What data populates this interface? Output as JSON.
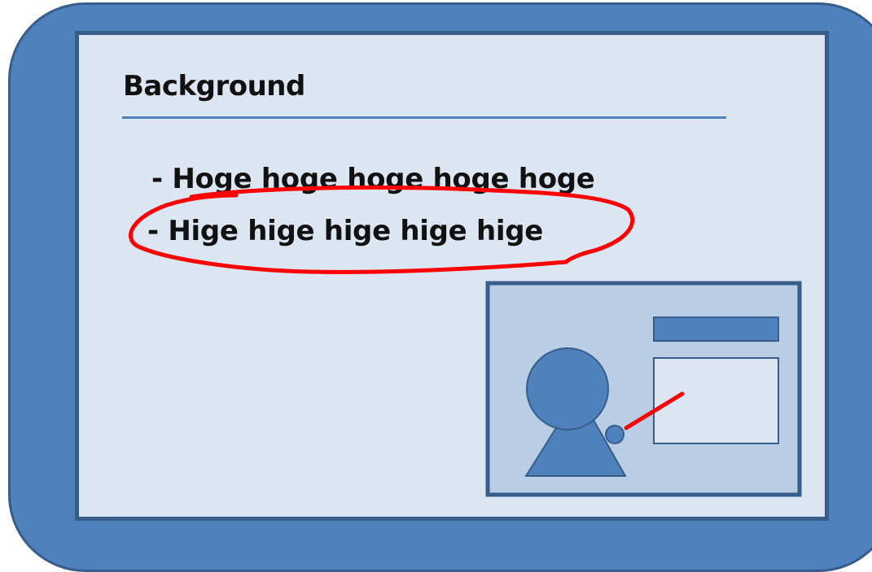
{
  "slide": {
    "title": "Background",
    "bullets": [
      "- Hoge hoge hoge hoge hoge",
      "- Hige hige hige hige hige"
    ]
  },
  "colors": {
    "frame_fill": "#4f81bd",
    "frame_border": "#385d8a",
    "slide_fill": "#dce6f2",
    "title_rule": "#4f81bd",
    "highlight_ellipse": "#ff0000",
    "presenter_panel_fill": "#b9cde5",
    "pointer": "#ff0000"
  },
  "annotations": {
    "highlighted_bullet": 1,
    "highlight_shape": "hand-drawn ellipse"
  },
  "icons": {
    "presenter_illustration": "presenter-pointing-at-screen-icon"
  }
}
